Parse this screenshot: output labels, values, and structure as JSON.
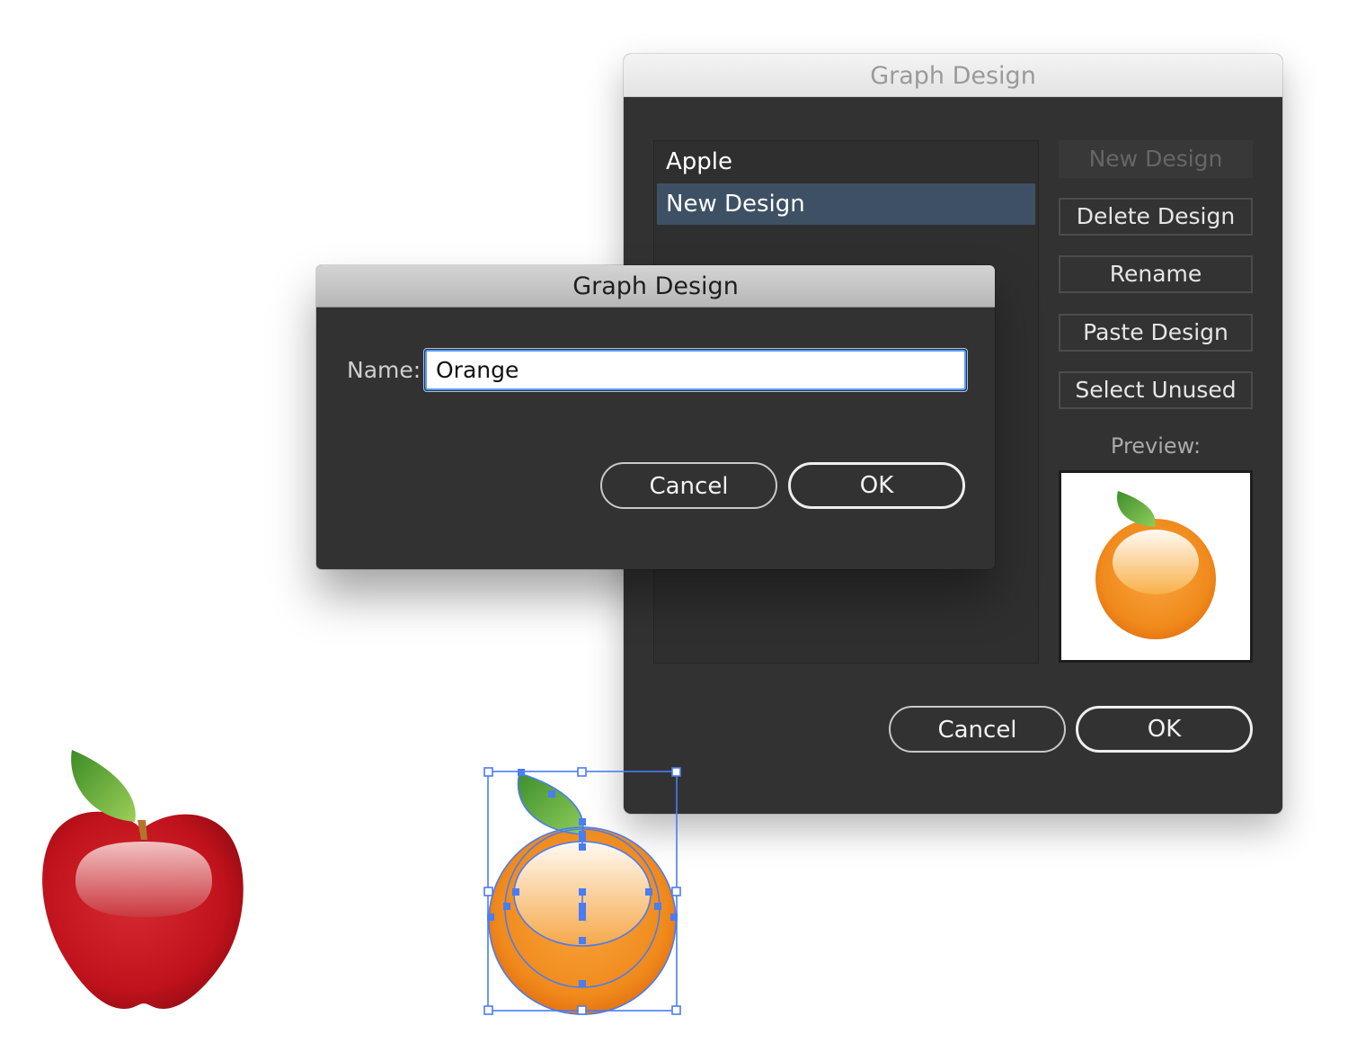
{
  "main_dialog": {
    "title": "Graph Design",
    "designs": [
      "Apple",
      "New Design"
    ],
    "selected_design": "New Design",
    "buttons": {
      "new_design": "New Design",
      "delete_design": "Delete Design",
      "rename": "Rename",
      "paste_design": "Paste Design",
      "select_unused": "Select Unused"
    },
    "preview_label": "Preview:",
    "preview_icon": "orange-icon",
    "cancel": "Cancel",
    "ok": "OK"
  },
  "name_dialog": {
    "title": "Graph Design",
    "name_label": "Name:",
    "name_value": "Orange",
    "cancel": "Cancel",
    "ok": "OK"
  },
  "canvas": {
    "artworks": [
      "apple-icon",
      "orange-icon"
    ],
    "selected_artwork": "orange-icon"
  },
  "colors": {
    "dialog_bg": "#323232",
    "list_selection": "#3e5064",
    "focus_ring": "#5a9bf0",
    "selection_handles": "#4a7cf2",
    "apple_red": "#c0121c",
    "orange": "#f08a1c",
    "leaf_green": "#5fae3a"
  }
}
